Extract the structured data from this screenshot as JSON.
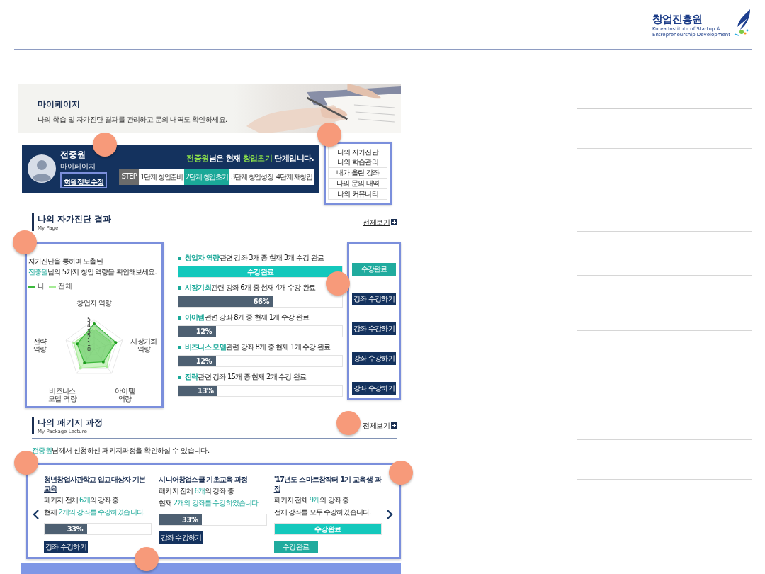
{
  "header": {
    "logo": {
      "name": "창업진흥원",
      "subtitle": "Korea Institute of Startup & Entrepreneurship Development"
    }
  },
  "banner": {
    "title": "마이페이지",
    "subtitle": "나의 학습 및 자가진단 결과를 관리하고 문의 내역도 확인하세요."
  },
  "profile": {
    "name": "전중원",
    "caption": "마이페이지",
    "edit_button": "회원정보수정",
    "status": [
      {
        "text": "전중원",
        "accent": true
      },
      {
        "text": "님은 현재 ",
        "accent": false
      },
      {
        "text": "창업초기",
        "accent": true
      },
      {
        "text": " 단계입니다.",
        "accent": false
      }
    ],
    "step_label": "STEP",
    "steps": [
      {
        "label": "1단계 창업준비",
        "selected": false
      },
      {
        "label": "2단계 창업초기",
        "selected": true
      },
      {
        "label": "3단계 창업성장",
        "selected": false
      },
      {
        "label": "4단계 재창업",
        "selected": false
      }
    ]
  },
  "side_menu": [
    "나의 자가진단",
    "나의 학습관리",
    "내가 올린 강좌",
    "나의 문의 내역",
    "나의 커뮤니티"
  ],
  "diagnosis": {
    "title": "나의 자가진단 결과",
    "subtitle": "My Page",
    "more": "전체보기",
    "intro": "자가진단을 통하여 도출된",
    "intro2": [
      {
        "text": "전중원",
        "accent": true
      },
      {
        "text": "님의 5가지 창업 역량을 확인해보세요.",
        "accent": false
      }
    ],
    "legend": [
      {
        "label": "나",
        "color": "#3cb83c"
      },
      {
        "label": "전체",
        "color": "#a6eb96"
      }
    ],
    "radar": {
      "axes": [
        {
          "lines": [
            "창업자 역량"
          ]
        },
        {
          "lines": [
            "시장기회",
            "역량"
          ]
        },
        {
          "lines": [
            "아이템",
            "역량"
          ]
        },
        {
          "lines": [
            "비즈니스",
            "모델 역량"
          ]
        },
        {
          "lines": [
            "전략",
            "역량"
          ]
        }
      ],
      "ticks": [
        "5",
        "4",
        "3",
        "2",
        "1",
        "0"
      ]
    },
    "courses": [
      {
        "highlight": "창업자 역량",
        "text": " 관련 강좌 3개 중 현재 3개 수강 완료",
        "level": 1,
        "reading": "수강완료",
        "complete": true,
        "button": {
          "label": "수강완료",
          "kind": "done"
        }
      },
      {
        "highlight": "시장기회",
        "text": " 관련 강좌 6개 중 현재 4개 수강 완료",
        "level": 0.58,
        "reading": "66%",
        "complete": false,
        "button": {
          "label": "강좌 수강하기",
          "kind": "take"
        }
      },
      {
        "highlight": "아이템",
        "text": " 관련 강좌 8개 중 현재 1개 수강 완료",
        "level": 0.23,
        "reading": "12%",
        "complete": false,
        "button": {
          "label": "강좌 수강하기",
          "kind": "take"
        }
      },
      {
        "highlight": "비즈니스 모델",
        "text": " 관련 강좌 8개 중 현재 1개 수강 완료",
        "level": 0.23,
        "reading": "12%",
        "complete": false,
        "button": {
          "label": "강좌 수강하기",
          "kind": "take"
        }
      },
      {
        "highlight": "전략",
        "text": " 관련 강좌 15개 중 현재 2개 수강 완료",
        "level": 0.24,
        "reading": "13%",
        "complete": false,
        "button": {
          "label": "강좌 수강하기",
          "kind": "take"
        }
      }
    ]
  },
  "package": {
    "title": "나의 패키지 과정",
    "subtitle": "My Package Lecture",
    "more": "전체보기",
    "intro": [
      {
        "text": "전중원",
        "accent": true
      },
      {
        "text": "님께서 신청하신 패키지과정을 확인하실 수 있습니다.",
        "accent": false
      }
    ],
    "cards": [
      {
        "title": "청년창업사관학교 입교대상자 기본교육",
        "lines": [
          [
            {
              "text": "패키지 전체 ",
              "accent": false
            },
            {
              "text": "6개",
              "accent": true
            },
            {
              "text": "의 강좌 중",
              "accent": false
            }
          ],
          [
            {
              "text": "현재 ",
              "accent": false
            },
            {
              "text": "2개의 강좌를 수강하였습니다.",
              "accent": true
            }
          ]
        ],
        "level": 0.4,
        "reading": "33%",
        "complete": false,
        "button": {
          "label": "강좌 수강하기",
          "kind": "take"
        }
      },
      {
        "title": "시니어창업스쿨 기초교육 과정",
        "lines": [
          [
            {
              "text": "패키지 전체 ",
              "accent": false
            },
            {
              "text": "6개",
              "accent": true
            },
            {
              "text": "의 강좌 중",
              "accent": false
            }
          ],
          [
            {
              "text": "현재 ",
              "accent": false
            },
            {
              "text": "2개의 강좌를 수강하였습니다.",
              "accent": true
            }
          ]
        ],
        "level": 0.4,
        "reading": "33%",
        "complete": false,
        "button": {
          "label": "강좌 수강하기",
          "kind": "take"
        }
      },
      {
        "title": "'17년도 스마트창작터 1기 교육생 과정",
        "lines": [
          [
            {
              "text": "패키지 전체 ",
              "accent": false
            },
            {
              "text": "9개",
              "accent": true
            },
            {
              "text": "의 강좌 중",
              "accent": false
            }
          ],
          [
            {
              "text": "전체 강좌를 모두 수강하였습니다.",
              "accent": false
            }
          ]
        ],
        "level": 1,
        "reading": "수강완료",
        "complete": true,
        "button": {
          "label": "수강완료",
          "kind": "done"
        }
      }
    ]
  }
}
